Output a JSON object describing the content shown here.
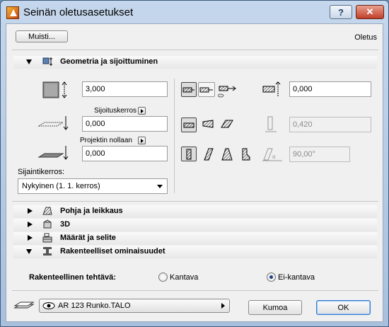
{
  "window": {
    "title": "Seinän oletusasetukset"
  },
  "header": {
    "memory_button": "Muisti...",
    "defaults_label": "Oletus"
  },
  "geometry": {
    "title": "Geometria ja sijoittuminen",
    "height_value": "3,000",
    "placement_layer_label": "Sijoituskerros",
    "offset_value": "0,000",
    "project_zero_label": "Projektin nollaan",
    "elevation_value": "0,000",
    "home_story_label": "Sijaintikerros:",
    "home_story_value": "Nykyinen (1. 1. kerros)",
    "thickness_value": "0,000",
    "slant_thickness_value": "0,420",
    "angle_value": "90,00°"
  },
  "sections": {
    "floor_plan": "Pohja ja leikkaus",
    "three_d": "3D",
    "listing": "Määrät ja selite",
    "structural": "Rakenteelliset ominaisuudet"
  },
  "structural": {
    "function_label": "Rakenteellinen tehtävä:",
    "option_load_bearing": "Kantava",
    "option_non_load_bearing": "Ei-kantava",
    "selected": "Ei-kantava"
  },
  "footer": {
    "layer_value": "AR 123 Runko.TALO",
    "cancel_button": "Kumoa",
    "ok_button": "OK"
  }
}
